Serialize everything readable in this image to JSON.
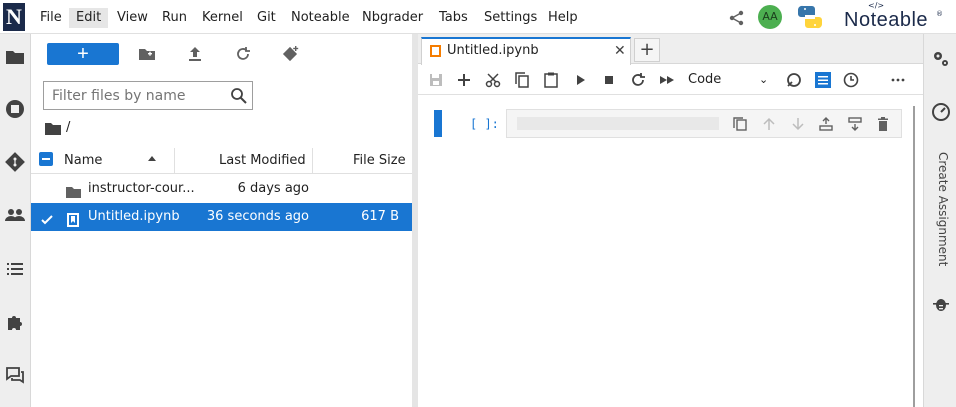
{
  "menubar": {
    "logo_letter": "N",
    "items": [
      "File",
      "Edit",
      "View",
      "Run",
      "Kernel",
      "Git",
      "Noteable",
      "Nbgrader",
      "Tabs",
      "Settings",
      "Help"
    ],
    "active_item": "Edit",
    "avatar_initials": "AA",
    "brand": "Noteable",
    "brand_tag": "</>",
    "brand_reg": "®"
  },
  "filebrowser": {
    "new_button_label": "+",
    "filter_placeholder": "Filter files by name",
    "breadcrumb": "/",
    "columns": {
      "name": "Name",
      "modified": "Last Modified",
      "size": "File Size"
    },
    "rows": [
      {
        "name": "instructor-cour...",
        "modified": "6 days ago",
        "size": "",
        "type": "folder",
        "selected": false
      },
      {
        "name": "Untitled.ipynb",
        "modified": "36 seconds ago",
        "size": "617 B",
        "type": "notebook",
        "selected": true
      }
    ]
  },
  "notebook": {
    "tab_label": "Untitled.ipynb",
    "tab_close": "✕",
    "add_tab": "+",
    "cell_type": "Code",
    "cell_prompt": "[ ]:"
  },
  "right_panel": {
    "create_assignment": "Create Assignment"
  },
  "colors": {
    "accent": "#1976d2",
    "notebook_icon": "#f57c00",
    "avatar": "#4caf50"
  }
}
